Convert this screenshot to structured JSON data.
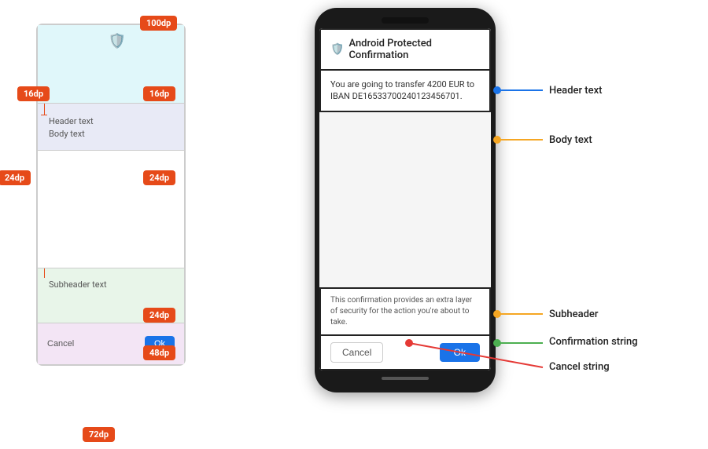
{
  "left": {
    "badges": {
      "dp100": "100dp",
      "dp16_top": "16dp",
      "dp16_header": "16dp",
      "dp24_left": "24dp",
      "dp24_right": "24dp",
      "dp24_sub": "24dp",
      "dp48": "48dp",
      "dp72": "72dp"
    },
    "header_text": "Header text",
    "body_text": "Body text",
    "subheader_text": "Subheader text",
    "cancel_label": "Cancel",
    "ok_label": "Ok"
  },
  "right": {
    "title": "Android Protected Confirmation",
    "body": "You are going to transfer 4200 EUR to IBAN DE16533700240123456701.",
    "subheader": "This confirmation provides an extra layer of security for the action you're about to take.",
    "cancel_label": "Cancel",
    "ok_label": "Ok",
    "annotations": {
      "header_text": "Header text",
      "body_text": "Body text",
      "subheader": "Subheader",
      "confirmation_string": "Confirmation string",
      "cancel_string": "Cancel string"
    }
  }
}
